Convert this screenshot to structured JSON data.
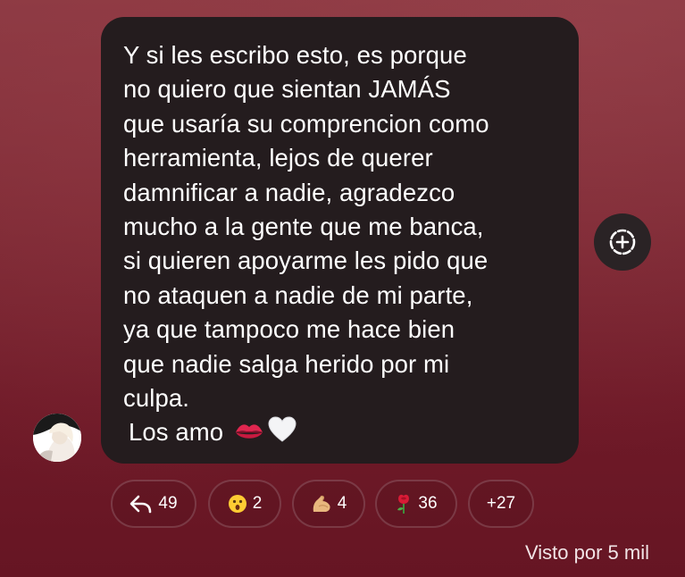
{
  "message": {
    "lines": [
      "Y si les escribo esto, es porque",
      "no quiero que sientan JAMÁS",
      "que usaría su comprencion como",
      "herramienta, lejos de querer",
      "damnificar a nadie, agradezco",
      "mucho a la gente que me banca,",
      "si quieren apoyarme les pido que",
      "no ataquen a nadie de mi parte,",
      "ya que tampoco me hace bien",
      "que nadie salga herido por mi",
      "culpa."
    ],
    "sign_off": "Los amo"
  },
  "reactions": [
    {
      "icon": "reply-icon",
      "count": "49"
    },
    {
      "icon": "surprised-face-icon",
      "count": "2"
    },
    {
      "icon": "flexed-biceps-icon",
      "count": "4"
    },
    {
      "icon": "rose-icon",
      "count": "36"
    },
    {
      "icon": "",
      "count": "+27"
    }
  ],
  "seen_by": "Visto por 5 mil",
  "colors": {
    "bubble": "#241c1e",
    "background": "#7d2a35",
    "text": "#ffffff"
  }
}
